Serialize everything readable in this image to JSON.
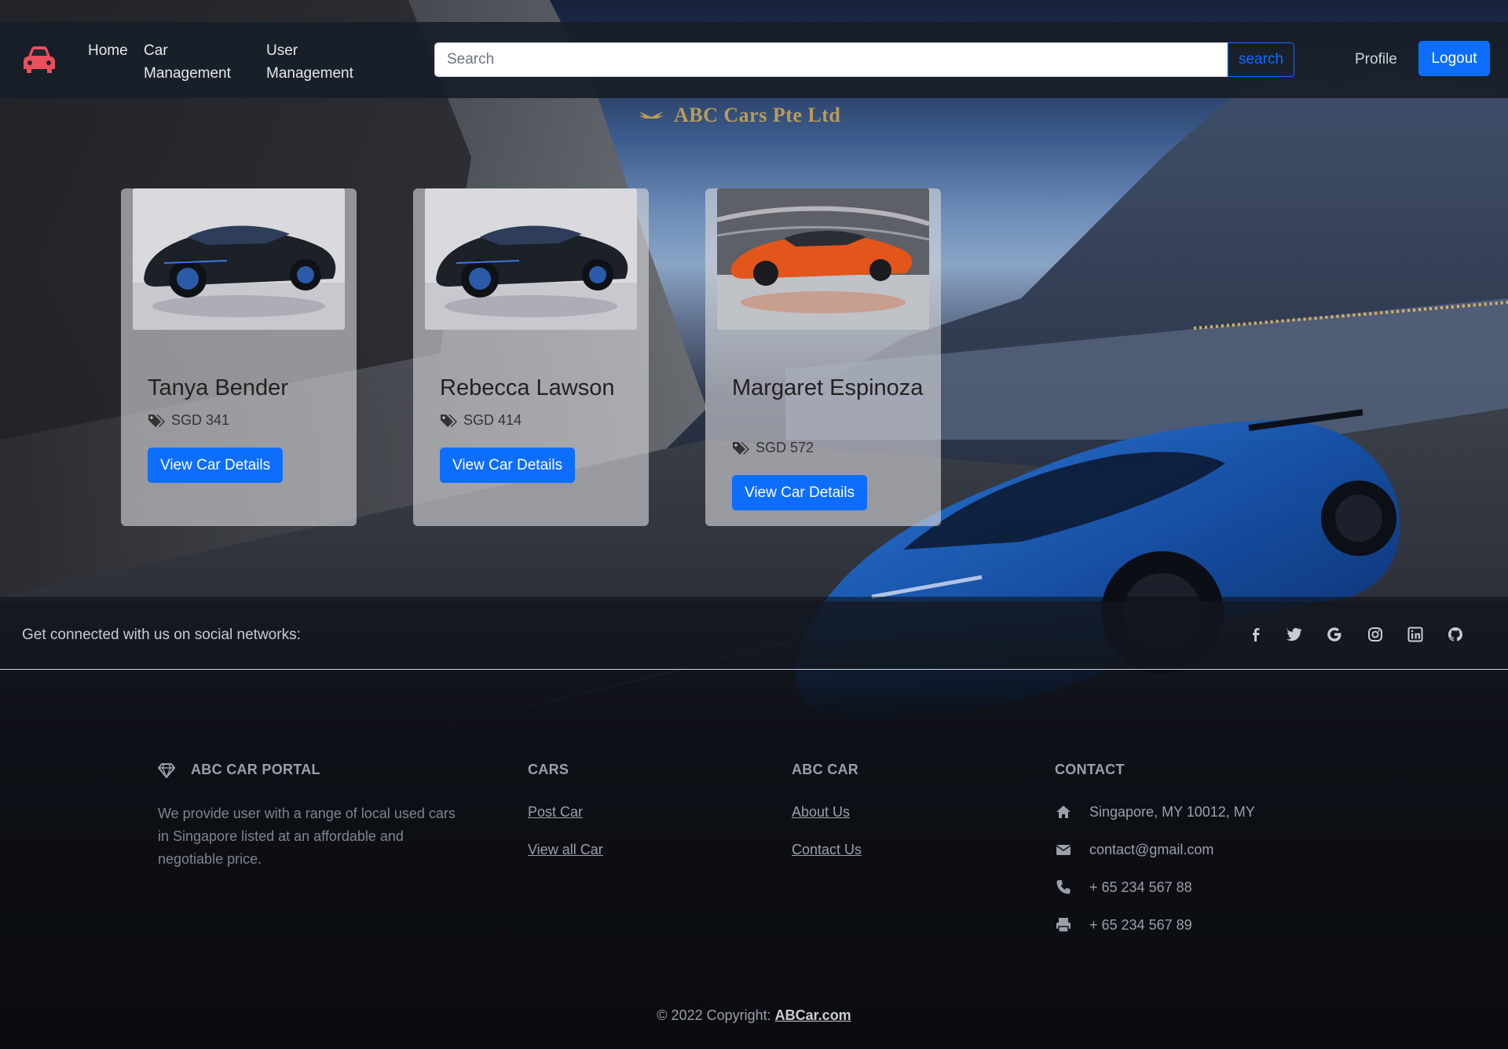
{
  "nav": {
    "home": "Home",
    "car_management": "Car Management",
    "user_management": "User Management",
    "search_placeholder": "Search",
    "search_button": "search",
    "profile": "Profile",
    "logout": "Logout"
  },
  "company_name": "ABC Cars Pte Ltd",
  "cards": [
    {
      "name": "Tanya Bender",
      "price": "SGD 341",
      "button": "View Car Details",
      "image": "black-concept-car"
    },
    {
      "name": "Rebecca Lawson",
      "price": "SGD 414",
      "button": "View Car Details",
      "image": "black-concept-car"
    },
    {
      "name": "Margaret Espinoza",
      "price": "SGD 572",
      "button": "View Car Details",
      "image": "orange-sports-car"
    }
  ],
  "social": {
    "text": "Get connected with us on social networks:",
    "icons": [
      "facebook-icon",
      "twitter-icon",
      "google-icon",
      "instagram-icon",
      "linkedin-icon",
      "github-icon"
    ]
  },
  "footer": {
    "portal_heading": "ABC CAR PORTAL",
    "portal_desc": "We provide user with a range of local used cars in Singapore listed at an affordable and negotiable price.",
    "cars_heading": "CARS",
    "cars_links": [
      "Post Car",
      "View all Car"
    ],
    "abc_heading": "ABC CAR",
    "abc_links": [
      "About Us",
      "Contact Us"
    ],
    "contact_heading": "CONTACT",
    "contact": {
      "address": "Singapore, MY 10012, MY",
      "email": "contact@gmail.com",
      "phone": "+ 65 234 567 88",
      "fax": "+ 65 234 567 89"
    },
    "copyright_prefix": "© 2022 Copyright: ",
    "copyright_link": "ABCar.com"
  },
  "colors": {
    "primary": "#0d6efd",
    "brand_icon": "#e8505b",
    "company_gold": "#b99a5a"
  }
}
